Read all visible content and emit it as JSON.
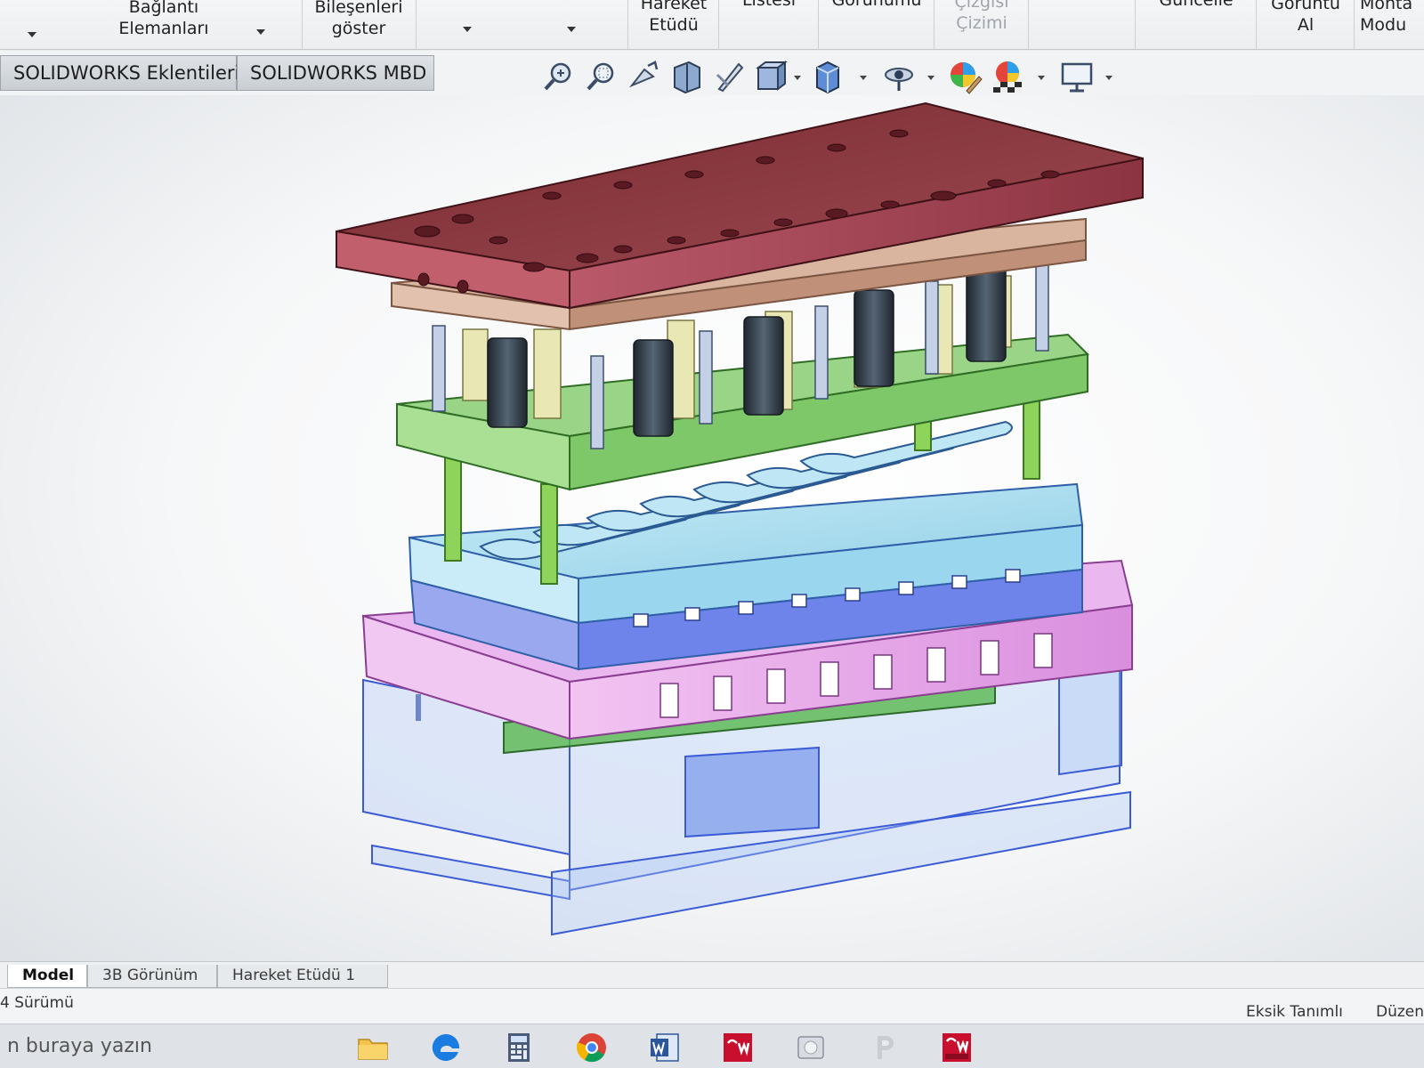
{
  "ribbon": {
    "items": [
      {
        "label_line1": "Bağlantı",
        "label_line2": "Elemanları"
      },
      {
        "label_line1": "Bileşenleri",
        "label_line2": "göster"
      },
      {
        "label_line1": "Hareket",
        "label_line2": "Etüdü"
      },
      {
        "label_line1": "Listesi",
        "label_line2": ""
      },
      {
        "label_line1": "Görünümü",
        "label_line2": ""
      },
      {
        "label_line1": "Çizgisi",
        "label_line2": "Çizimi"
      },
      {
        "label_line1": "Güncelle",
        "label_line2": ""
      },
      {
        "label_line1": "Görüntü",
        "label_line2": "Al"
      },
      {
        "label_line1": "Monta",
        "label_line2": "Modu"
      }
    ]
  },
  "command_tabs": [
    {
      "label": "SOLIDWORKS Eklentileri"
    },
    {
      "label": "SOLIDWORKS MBD"
    }
  ],
  "view_toolbar": {
    "icons": [
      "zoom-to-fit-icon",
      "zoom-to-area-icon",
      "previous-view-icon",
      "section-view-icon",
      "dynamic-annotation-icon",
      "view-orientation-icon",
      "display-style-icon",
      "hide-show-icon",
      "edit-appearance-icon",
      "apply-scene-icon",
      "view-settings-icon"
    ]
  },
  "bottom_tabs": [
    {
      "label": "Model",
      "active": true
    },
    {
      "label": "3B Görünüm",
      "active": false
    },
    {
      "label": "Hareket Etüdü 1",
      "active": false
    }
  ],
  "status": {
    "version_text": "4 Sürümü",
    "definition_state": "Eksik Tanımlı",
    "edit_state": "Düzen"
  },
  "taskbar": {
    "search_placeholder": "n buraya yazın",
    "apps": [
      "file-explorer-icon",
      "edge-icon",
      "calculator-icon",
      "chrome-icon",
      "word-icon",
      "solidworks-icon",
      "media-icon",
      "powerpoint-icon",
      "solidworks-2017-icon"
    ]
  },
  "colors": {
    "top_plate": "#8a2f3a",
    "punch_holder": "#c7a38e",
    "stripper_plate": "#8cd07e",
    "die_plate": "#a9def0",
    "die_holder": "#e6a6e8",
    "die_shoe": "#a8c6f5",
    "springs": "#2d3844",
    "pillars": "#aebed6"
  }
}
